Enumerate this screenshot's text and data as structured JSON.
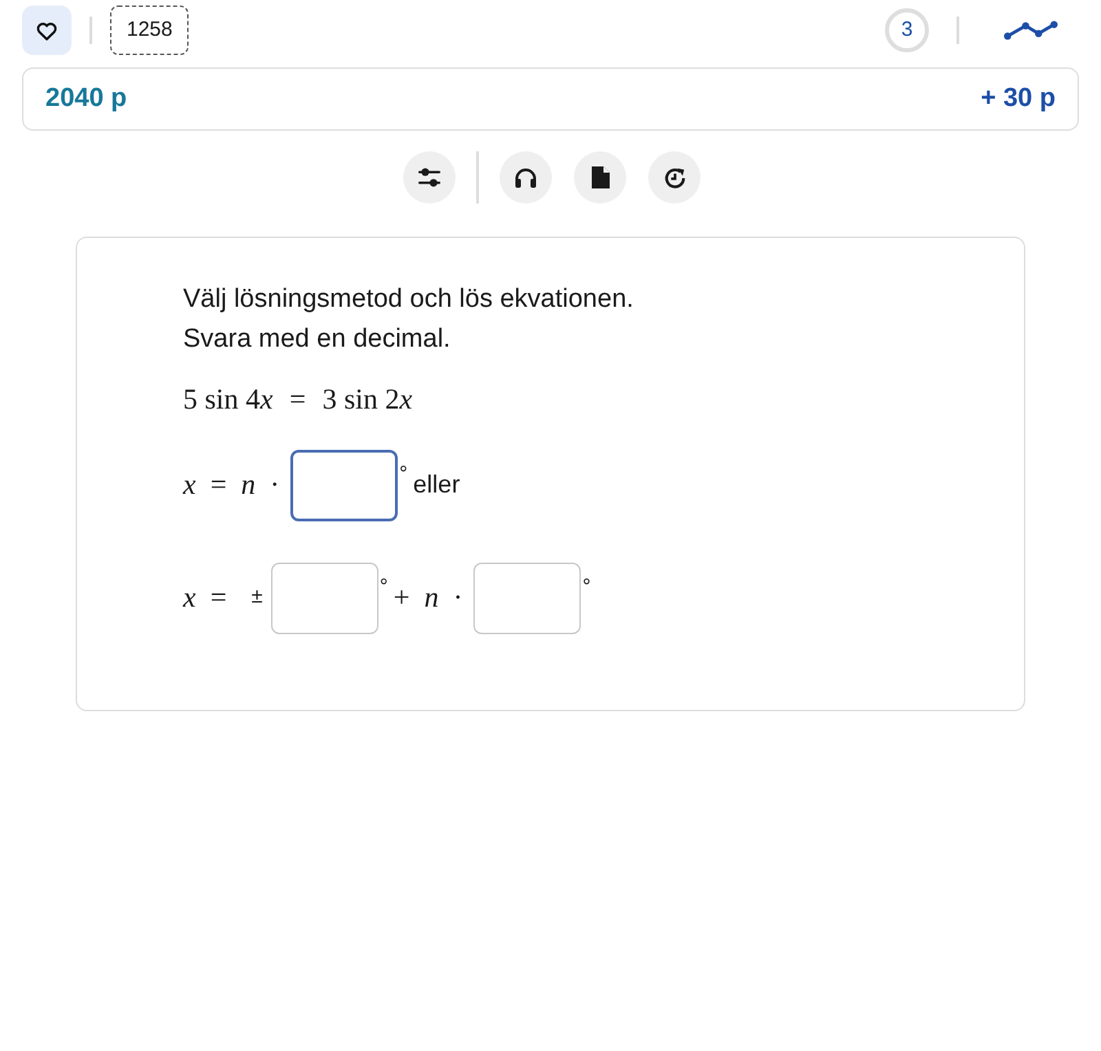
{
  "header": {
    "task_number": "1258",
    "counter": "3"
  },
  "points": {
    "total": "2040 p",
    "gain": "+ 30 p"
  },
  "tool_groups": [
    [
      {
        "kind": "sliders"
      }
    ],
    [
      {
        "kind": "headphones"
      },
      {
        "kind": "document"
      },
      {
        "kind": "restart"
      }
    ]
  ],
  "question": {
    "instructions": [
      "Välj lösningsmetod och lös ekvationen.",
      "Svara med en decimal."
    ],
    "equation": [
      {
        "text": "5 sin 4",
        "italic": false
      },
      {
        "text": "x",
        "italic": true
      },
      {
        "text": "=",
        "italic": false
      },
      {
        "text": "3 sin 2",
        "italic": false
      },
      {
        "text": "x",
        "italic": true
      }
    ],
    "answer_rows": [
      {
        "parts": [
          {
            "kind": "math",
            "text": "*x* = *n* ·"
          },
          {
            "kind": "field",
            "focused": true
          },
          {
            "kind": "unit",
            "text": "°"
          },
          {
            "kind": "text",
            "text": "eller"
          }
        ]
      },
      {
        "parts": [
          {
            "kind": "math",
            "text": "*x* ="
          },
          {
            "kind": "sign",
            "text": "±"
          },
          {
            "kind": "field",
            "focused": false
          },
          {
            "kind": "unit",
            "text": "°"
          },
          {
            "kind": "math",
            "text": "+ *n* ·"
          },
          {
            "kind": "field",
            "focused": false
          },
          {
            "kind": "unit",
            "text": "°"
          }
        ]
      }
    ]
  }
}
